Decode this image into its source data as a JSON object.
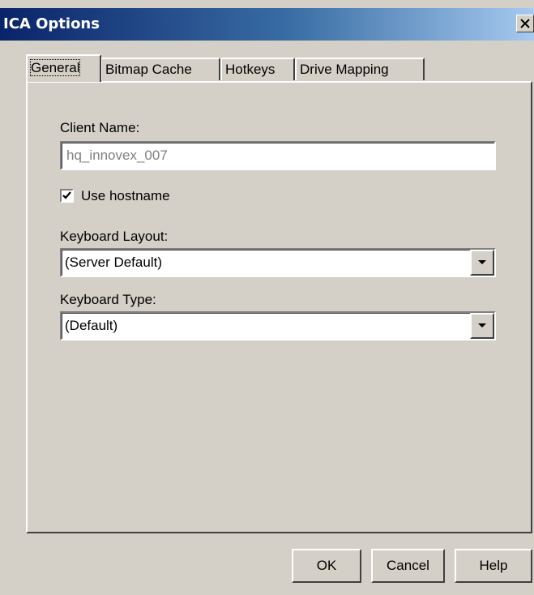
{
  "window": {
    "title": "ICA Options"
  },
  "tabs": [
    {
      "label": "General",
      "active": true
    },
    {
      "label": "Bitmap Cache",
      "active": false
    },
    {
      "label": "Hotkeys",
      "active": false
    },
    {
      "label": "Drive Mapping",
      "active": false
    }
  ],
  "general": {
    "client_name_label": "Client Name:",
    "client_name_value": "hq_innovex_007",
    "use_hostname_label": "Use hostname",
    "use_hostname_checked": true,
    "keyboard_layout_label": "Keyboard Layout:",
    "keyboard_layout_value": "(Server Default)",
    "keyboard_type_label": "Keyboard Type:",
    "keyboard_type_value": "(Default)"
  },
  "buttons": {
    "ok": "OK",
    "cancel": "Cancel",
    "help": "Help"
  },
  "colors": {
    "dialog_bg": "#d4d0c8",
    "titlebar_start": "#0a246a",
    "titlebar_end": "#a6caf0",
    "disabled_text": "#808080"
  }
}
